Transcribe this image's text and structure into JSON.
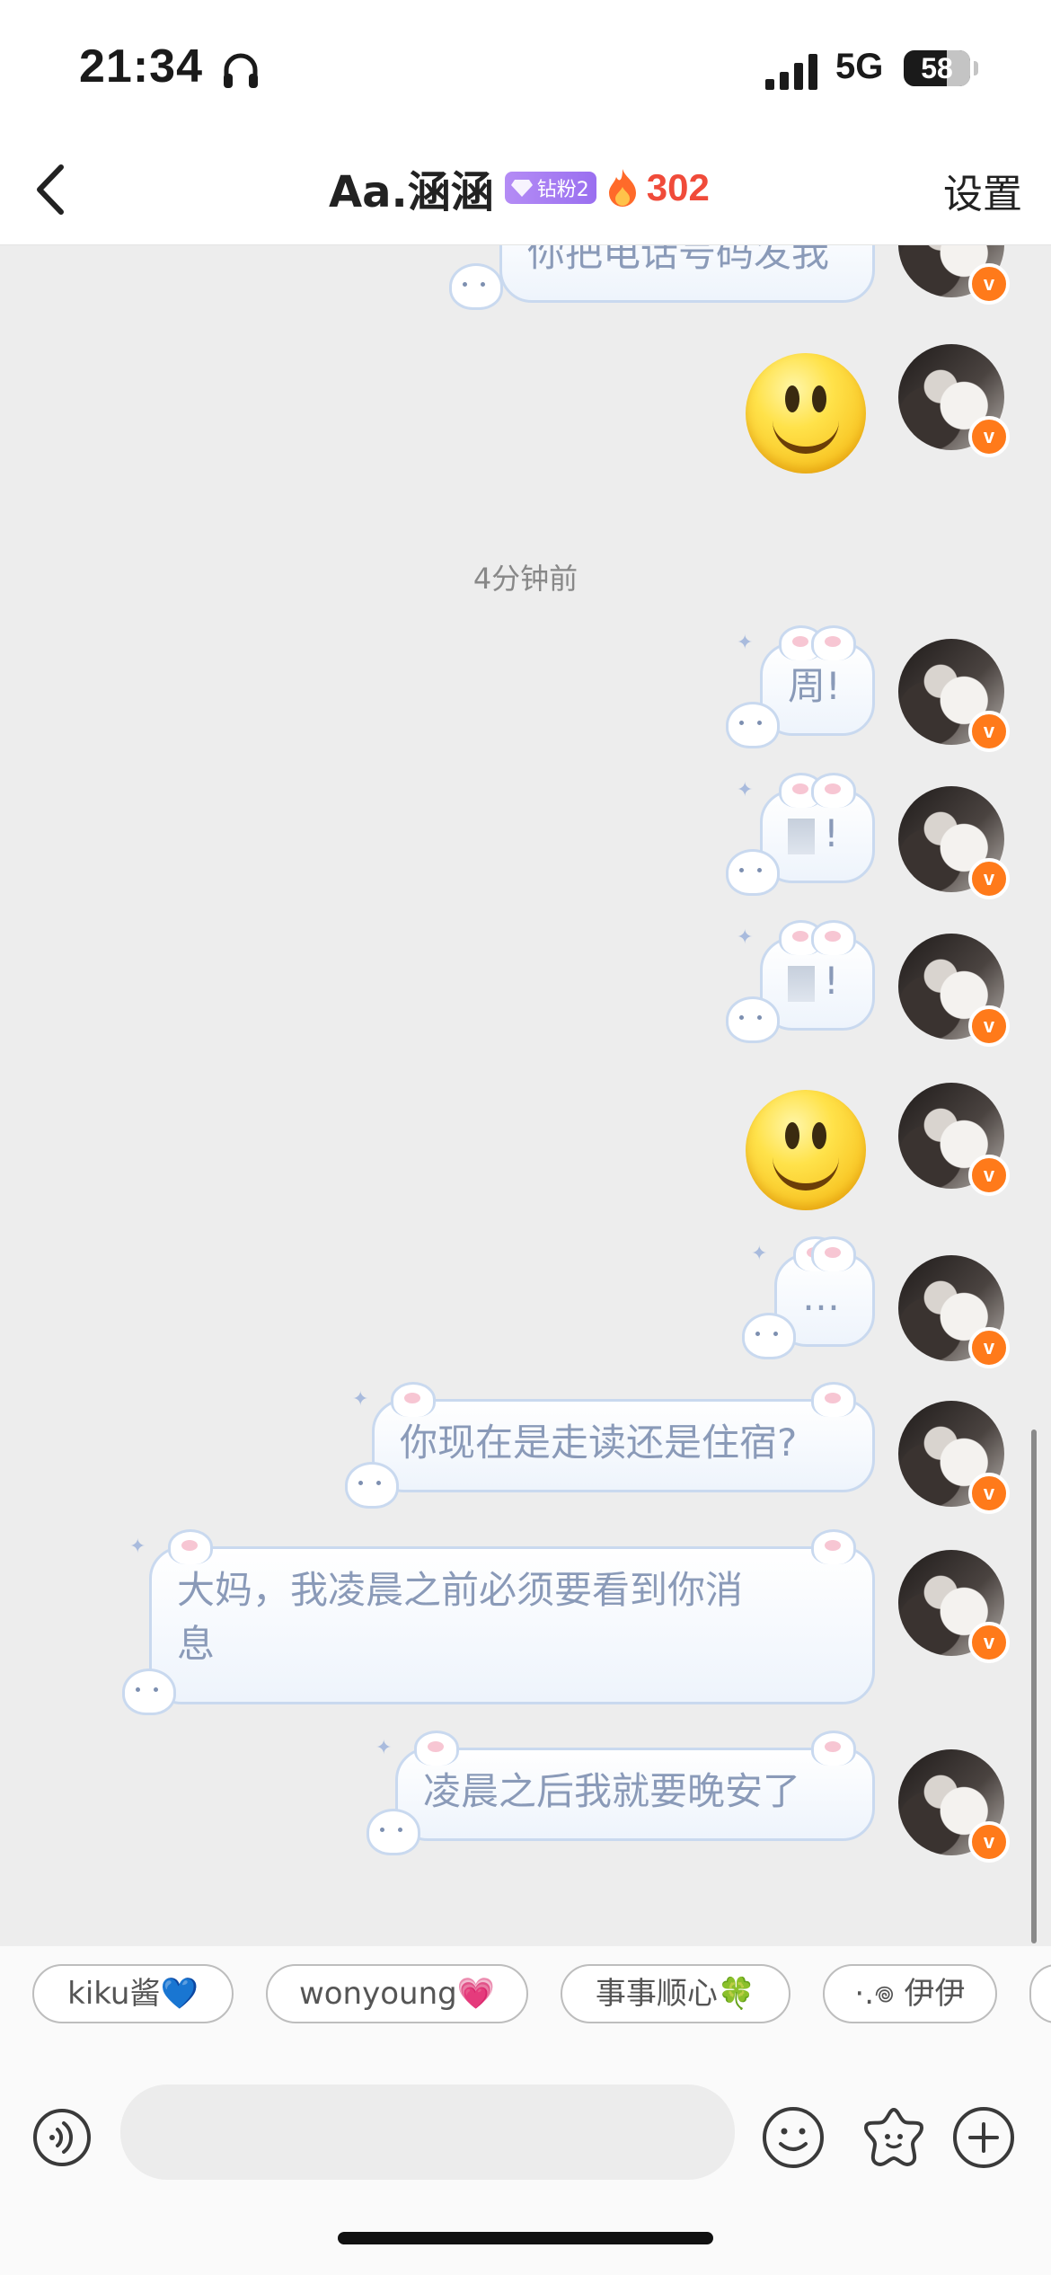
{
  "status_bar": {
    "time": "21:34",
    "network": "5G",
    "battery": "58"
  },
  "header": {
    "title": "Aa.涵涵",
    "fan_badge": "钻粉2",
    "streak": "302",
    "settings_label": "设置"
  },
  "chat": {
    "timestamp": "4分钟前",
    "messages": [
      {
        "text": "你把电话号码发我"
      },
      {
        "text": "周!"
      },
      {
        "text": "!"
      },
      {
        "text": "!"
      },
      {
        "text": "…"
      },
      {
        "text": "你现在是走读还是住宿?"
      },
      {
        "text": "大妈，我凌晨之前必须要看到你消\n息"
      },
      {
        "text": "凌晨之后我就要晚安了"
      }
    ]
  },
  "quick_tags": [
    {
      "label": "kiku酱💙"
    },
    {
      "label": "wonyoung💗"
    },
    {
      "label": "事事顺心🍀"
    },
    {
      "label": "·.𖦹 伊伊"
    }
  ],
  "icons": {
    "back": "back-arrow-icon",
    "headphone": "headphone-icon",
    "verified": "verified-v-icon",
    "voice": "voice-icon",
    "emoji": "emoji-icon",
    "sticker": "sticker-icon",
    "add": "plus-icon"
  },
  "colors": {
    "accent": "#f04b3a",
    "badge_purple": "#9a6ff0",
    "verified": "#ff7a1a",
    "bubble_border": "#c9d9ef",
    "bubble_text": "#8a9ab8"
  }
}
